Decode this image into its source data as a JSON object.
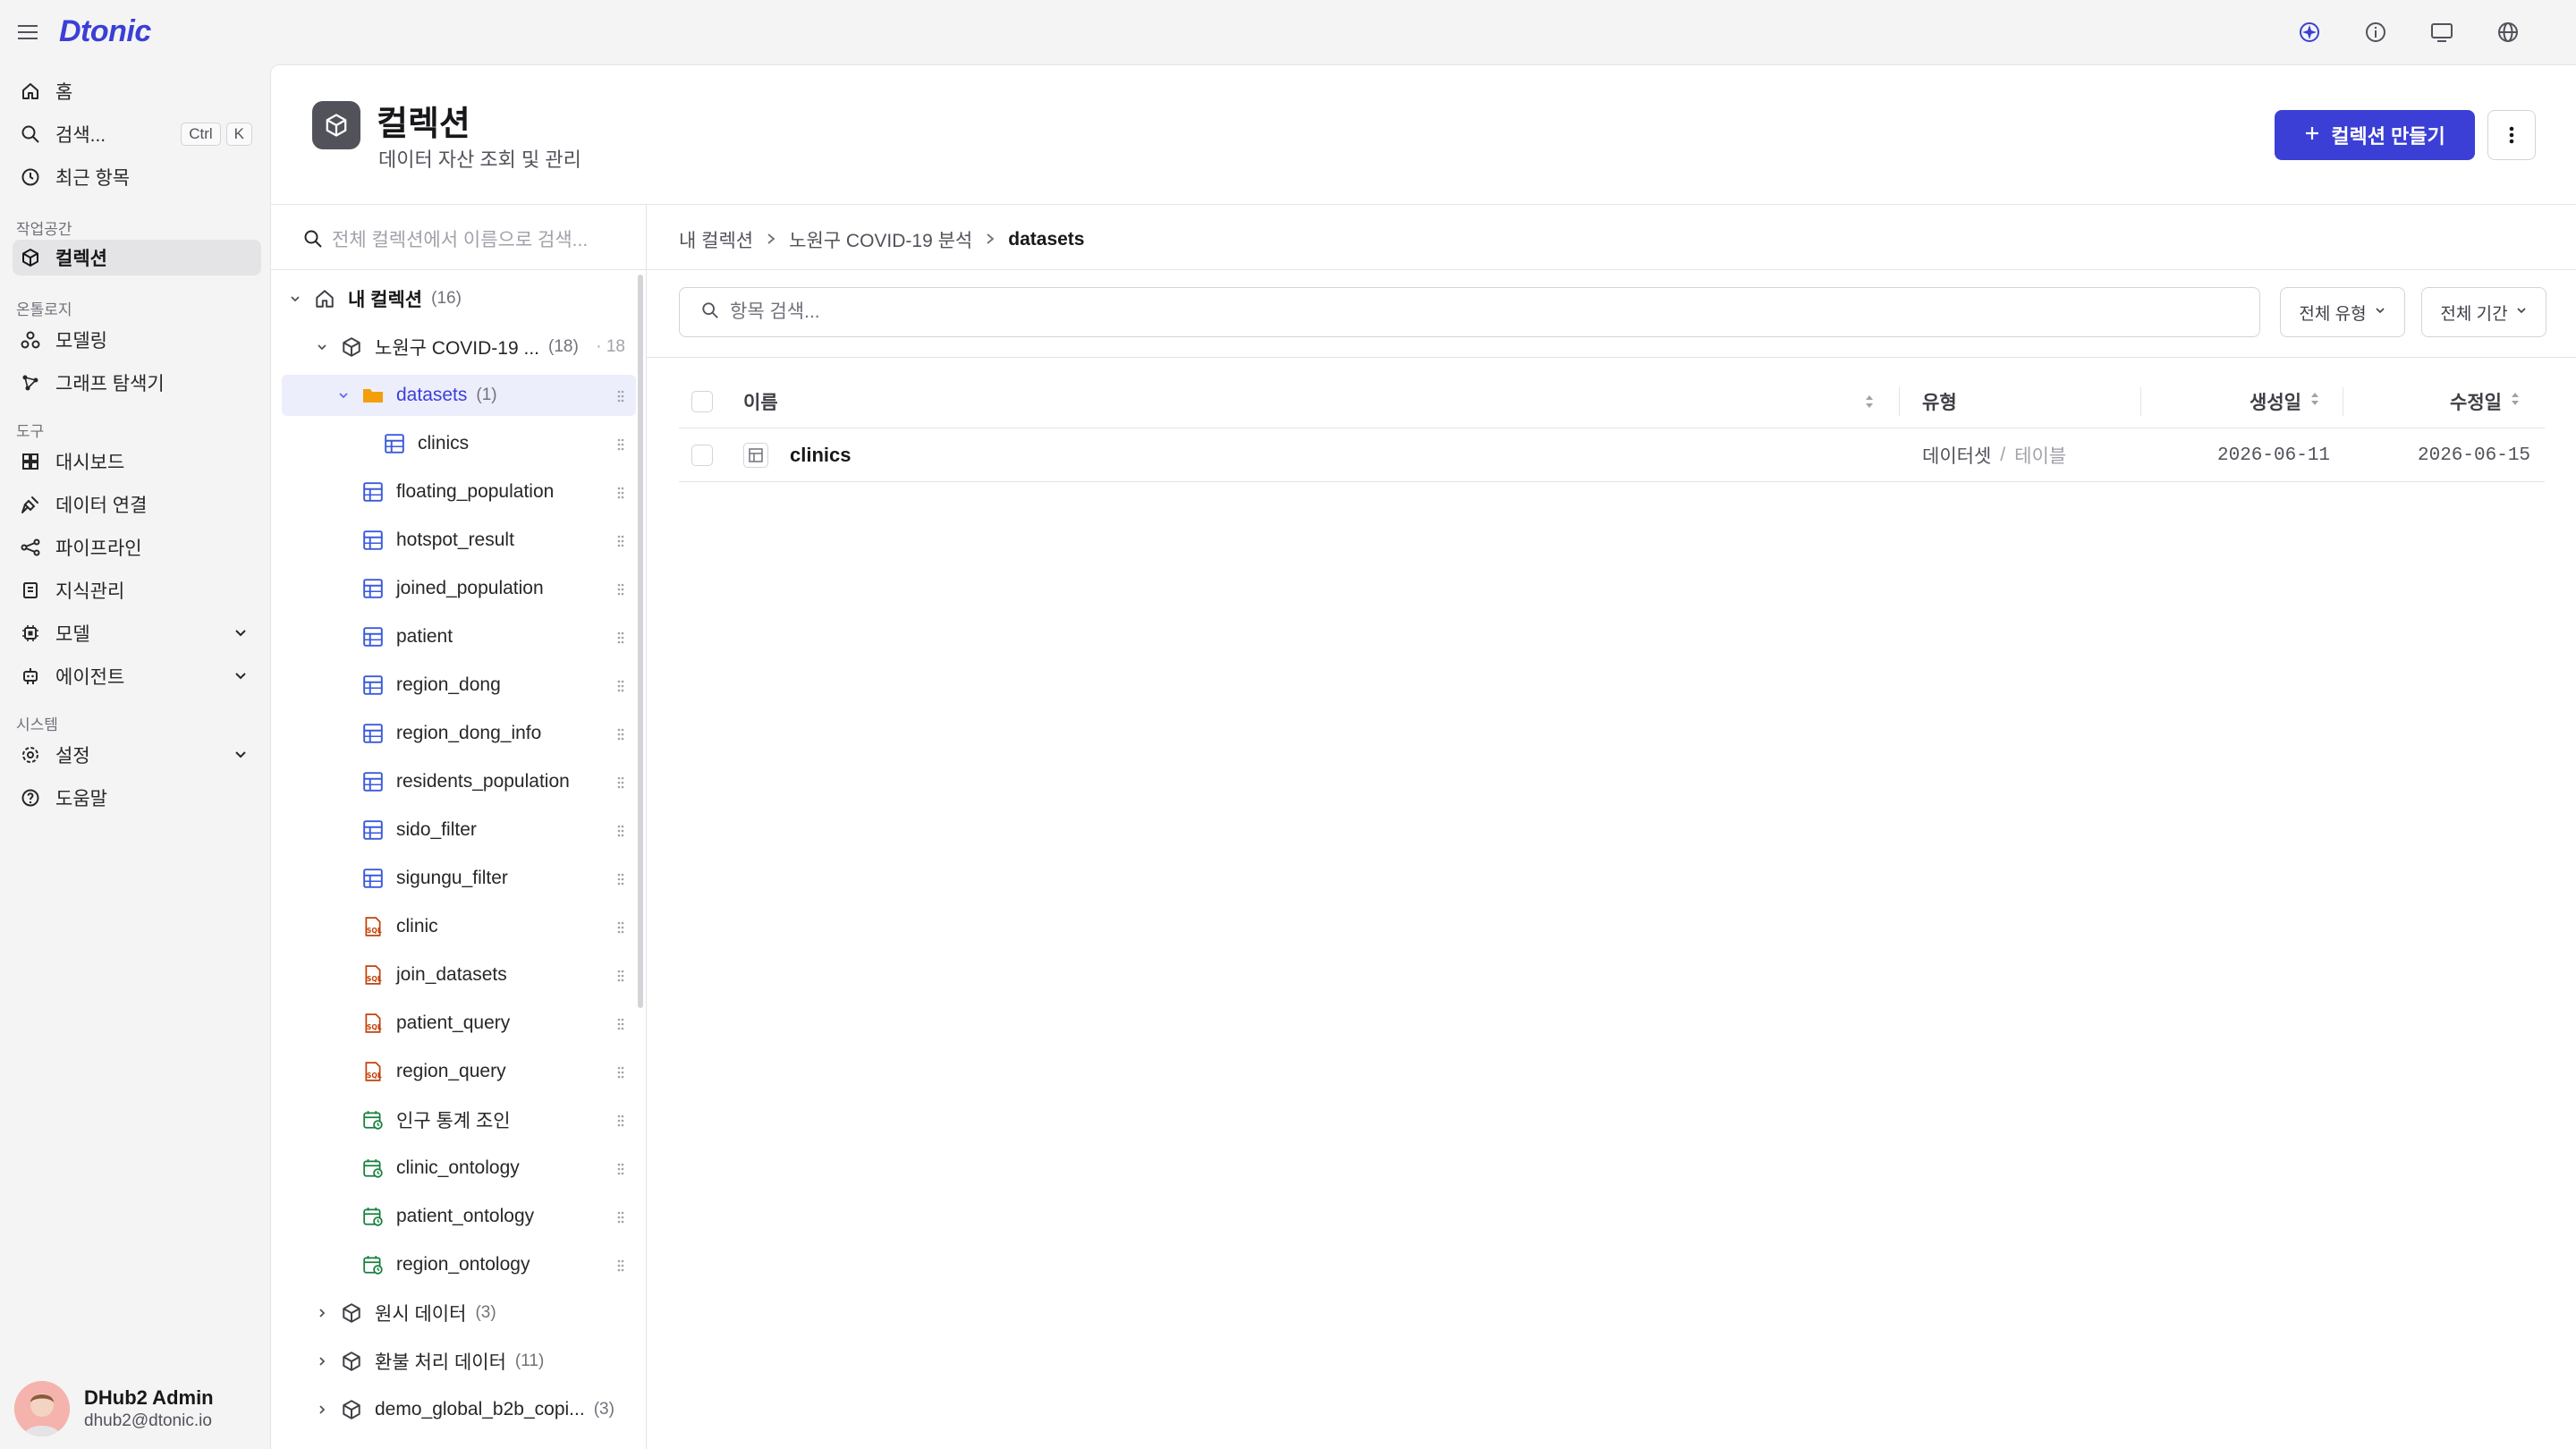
{
  "app": {
    "logo": "Dtonic"
  },
  "sidebar": {
    "home": "홈",
    "search": "검색...",
    "search_shortcut": [
      "Ctrl",
      "K"
    ],
    "recent": "최근 항목",
    "section_workspace": "작업공간",
    "collections": "컬렉션",
    "section_ontology": "온톨로지",
    "modeling": "모델링",
    "graph_explorer": "그래프 탐색기",
    "section_tools": "도구",
    "dashboard": "대시보드",
    "data_connection": "데이터 연결",
    "pipeline": "파이프라인",
    "knowledge": "지식관리",
    "model": "모델",
    "agent": "에이전트",
    "section_system": "시스템",
    "settings": "설정",
    "help": "도움말",
    "user": {
      "name": "DHub2 Admin",
      "email": "dhub2@dtonic.io"
    }
  },
  "header": {
    "title": "컬렉션",
    "subtitle": "데이터 자산 조회 및 관리",
    "create_label": "컬렉션 만들기"
  },
  "tree": {
    "search_placeholder": "전체 컬렉션에서 이름으로 검색...",
    "root": {
      "label": "내 컬렉션",
      "count": "(16)"
    },
    "collection": {
      "label": "노원구 COVID-19 ...",
      "count": "(18)",
      "extra": "· 18"
    },
    "folder": {
      "label": "datasets",
      "count": "(1)"
    },
    "folder_child": "clinics",
    "tables": [
      "floating_population",
      "hotspot_result",
      "joined_population",
      "patient",
      "region_dong",
      "region_dong_info",
      "residents_population",
      "sido_filter",
      "sigungu_filter"
    ],
    "queries": [
      "clinic",
      "join_datasets",
      "patient_query",
      "region_query"
    ],
    "ontologies": [
      "인구 통계 조인",
      "clinic_ontology",
      "patient_ontology",
      "region_ontology"
    ],
    "other_collections": [
      {
        "label": "원시 데이터",
        "count": "(3)"
      },
      {
        "label": "환불 처리 데이터",
        "count": "(11)"
      },
      {
        "label": "demo_global_b2b_copi...",
        "count": "(3)"
      }
    ]
  },
  "breadcrumb": [
    "내 컬렉션",
    "노원구 COVID-19 분석",
    "datasets"
  ],
  "content": {
    "search_placeholder": "항목 검색...",
    "filter_type": "전체 유형",
    "filter_period": "전체 기간",
    "columns": {
      "name": "이름",
      "type": "유형",
      "created": "생성일",
      "modified": "수정일"
    },
    "rows": [
      {
        "name": "clinics",
        "type_main": "데이터셋",
        "type_sep": "/",
        "type_sub": "테이블",
        "created": "2026-06-11",
        "modified": "2026-06-15"
      }
    ]
  },
  "colors": {
    "accent": "#3b3fd6",
    "selected_bg": "#eceefc",
    "table_icon": "#3b5bdb",
    "query_icon": "#c2410c",
    "ontology_icon": "#15803d",
    "folder_icon": "#f59e0b"
  }
}
